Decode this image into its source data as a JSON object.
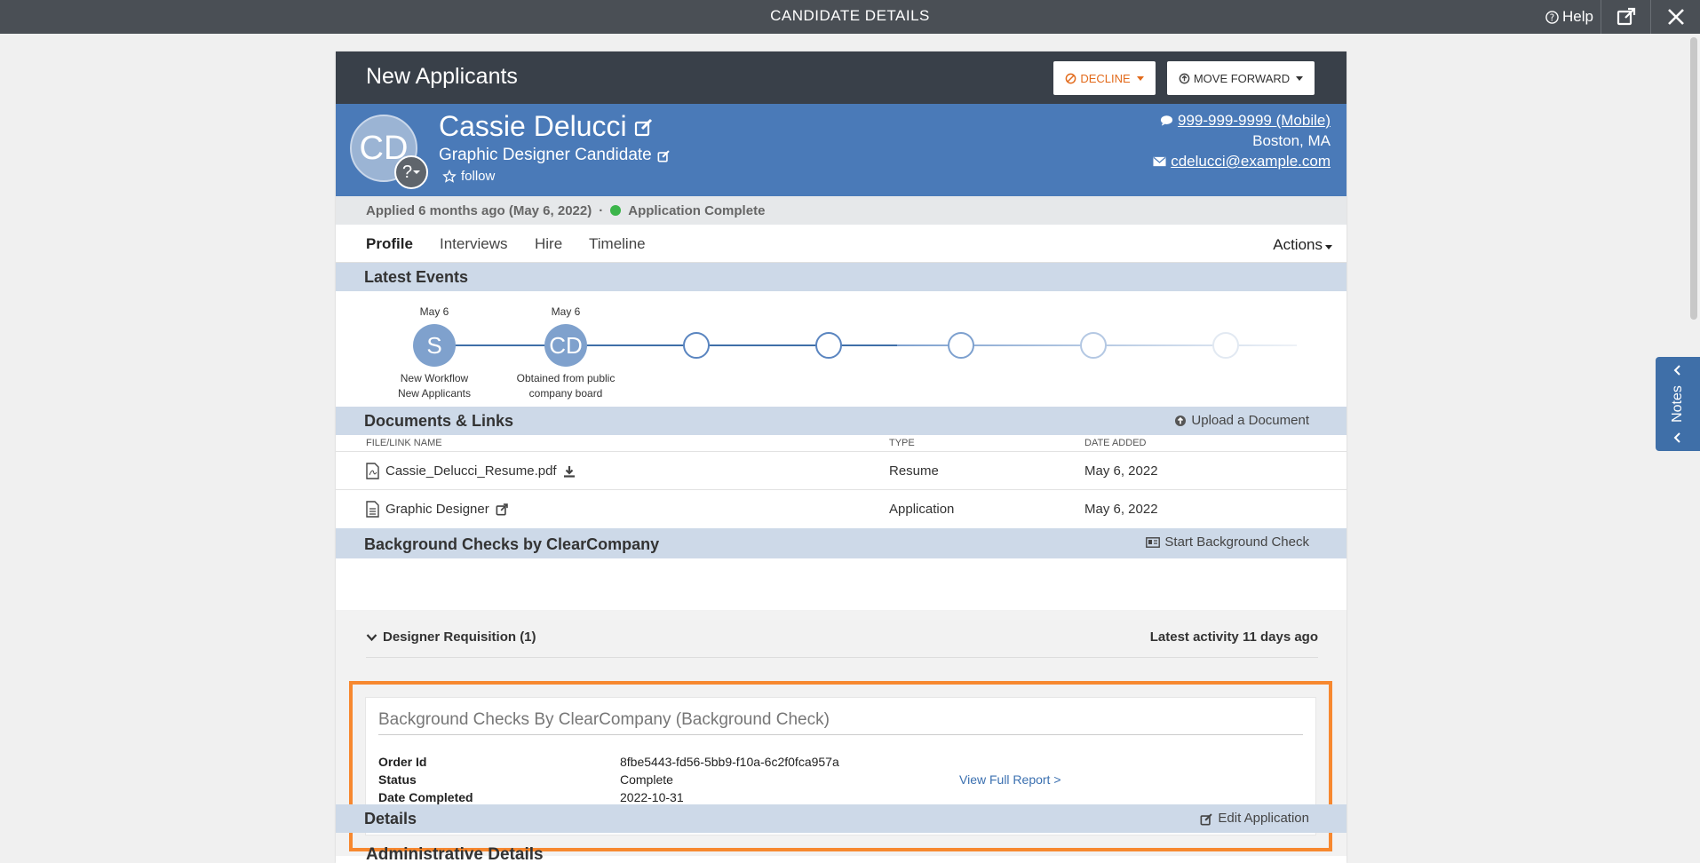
{
  "topbar": {
    "title": "CANDIDATE DETAILS",
    "help": "Help"
  },
  "stage": {
    "title": "New Applicants",
    "decline": "DECLINE",
    "move_forward": "MOVE FORWARD"
  },
  "candidate": {
    "initials": "CD",
    "avatar_badge": "?",
    "name": "Cassie Delucci",
    "job": "Graphic Designer Candidate",
    "follow": "follow",
    "phone": "999-999-9999 (Mobile)",
    "location": "Boston, MA",
    "email": "cdelucci@example.com"
  },
  "applied": {
    "text": "Applied 6 months ago (May 6, 2022)",
    "separator": "·",
    "status": "Application Complete"
  },
  "tabs": [
    "Profile",
    "Interviews",
    "Hire",
    "Timeline"
  ],
  "actions": "Actions",
  "latest_events": {
    "title": "Latest Events",
    "events": [
      {
        "date": "May 6",
        "initial": "S",
        "desc1": "New Workflow",
        "desc2": "New Applicants"
      },
      {
        "date": "May 6",
        "initial": "CD",
        "desc1": "Obtained from public",
        "desc2": "company board"
      }
    ]
  },
  "documents": {
    "title": "Documents & Links",
    "upload": "Upload a Document",
    "columns": {
      "name": "FILE/LINK NAME",
      "type": "TYPE",
      "date": "DATE ADDED"
    },
    "rows": [
      {
        "name": "Cassie_Delucci_Resume.pdf",
        "type": "Resume",
        "date": "May 6, 2022"
      },
      {
        "name": "Graphic Designer",
        "type": "Application",
        "date": "May 6, 2022"
      }
    ]
  },
  "background": {
    "title": "Background Checks by ClearCompany",
    "start": "Start Background Check",
    "requisition": "Designer Requisition (1)",
    "latest_activity": "Latest activity 11 days ago",
    "card_title": "Background Checks By ClearCompany (Background Check)",
    "order_label": "Order Id",
    "order_value": "8fbe5443-fd56-5bb9-f10a-6c2f0fca957a",
    "status_label": "Status",
    "status_value": "Complete",
    "date_label": "Date Completed",
    "date_value": "2022-10-31",
    "view_report": "View Full Report >"
  },
  "details": {
    "title": "Details",
    "edit": "Edit Application",
    "admin": "Administrative Details"
  },
  "notes": "Notes",
  "colors": {
    "header_dark": "#394049",
    "profile_blue": "#4a7ab8",
    "section_bar": "#cdd9e8",
    "highlight": "#f7882f",
    "decline": "#e26a1b",
    "status_green": "#3bb54a"
  }
}
